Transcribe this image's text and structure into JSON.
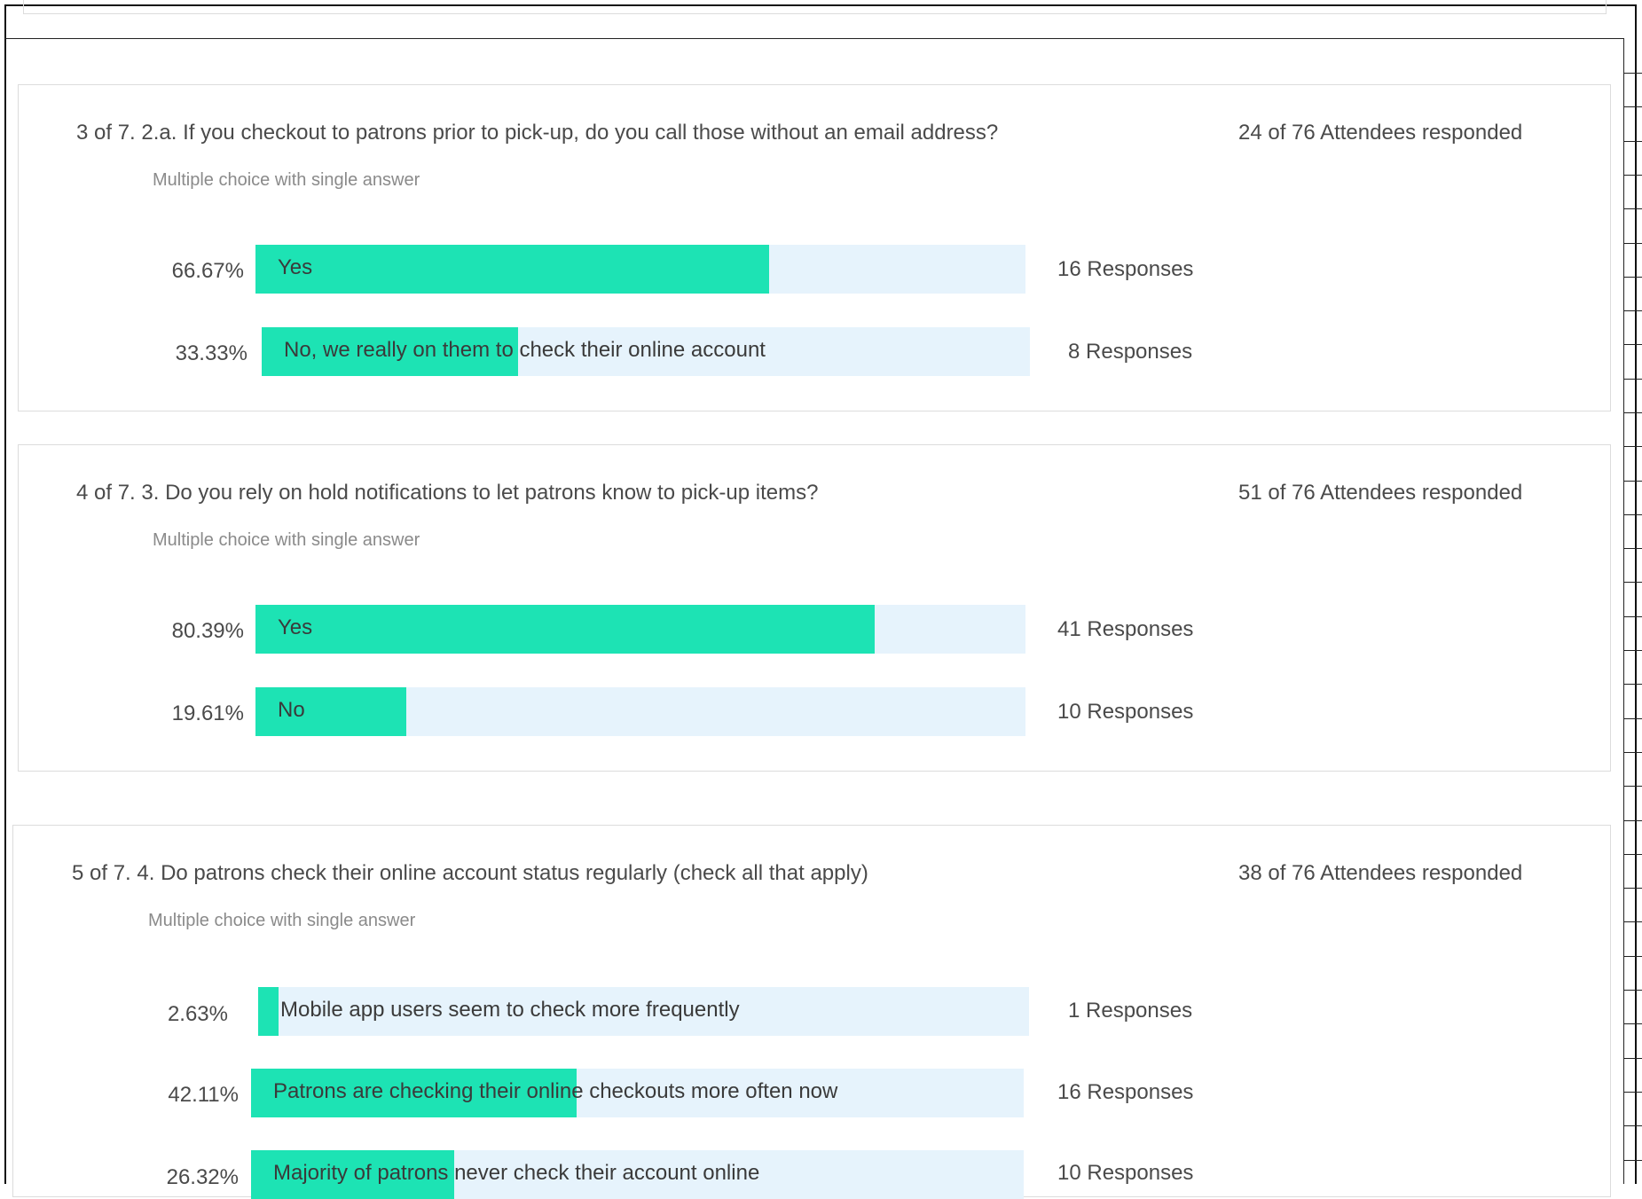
{
  "questions": [
    {
      "title": "3 of 7. 2.a. If you checkout to patrons prior to pick-up, do you call those without an email address?",
      "type": "Multiple choice with single answer",
      "responded": "24 of 76 Attendees responded",
      "options": [
        {
          "percent": "66.67%",
          "label": "Yes",
          "responses": "16 Responses",
          "fill": 0.6667
        },
        {
          "percent": "33.33%",
          "label": "No, we really on them to check their online account",
          "responses": "8 Responses",
          "fill": 0.3333
        }
      ]
    },
    {
      "title": "4 of 7. 3. Do you rely on hold notifications to let patrons know to pick-up items?",
      "type": "Multiple choice with single answer",
      "responded": "51 of 76 Attendees responded",
      "options": [
        {
          "percent": "80.39%",
          "label": "Yes",
          "responses": "41 Responses",
          "fill": 0.8039
        },
        {
          "percent": "19.61%",
          "label": "No",
          "responses": "10 Responses",
          "fill": 0.1961
        }
      ]
    },
    {
      "title": "5 of 7. 4. Do patrons check their online account status regularly (check all that apply)",
      "type": "Multiple choice with single answer",
      "responded": "38 of 76 Attendees responded",
      "options": [
        {
          "percent": "2.63%",
          "label": "Mobile app users seem to check more frequently",
          "responses": "1 Responses",
          "fill": 0.0263
        },
        {
          "percent": "42.11%",
          "label": "Patrons are checking their online checkouts more often now",
          "responses": "16 Responses",
          "fill": 0.4211
        },
        {
          "percent": "26.32%",
          "label": "Majority of patrons never check their account online",
          "responses": "10 Responses",
          "fill": 0.2632
        }
      ]
    }
  ],
  "colors": {
    "bar_fill": "#1de3b4",
    "bar_track": "#e6f3fc",
    "card_border": "#dcdcdc"
  }
}
